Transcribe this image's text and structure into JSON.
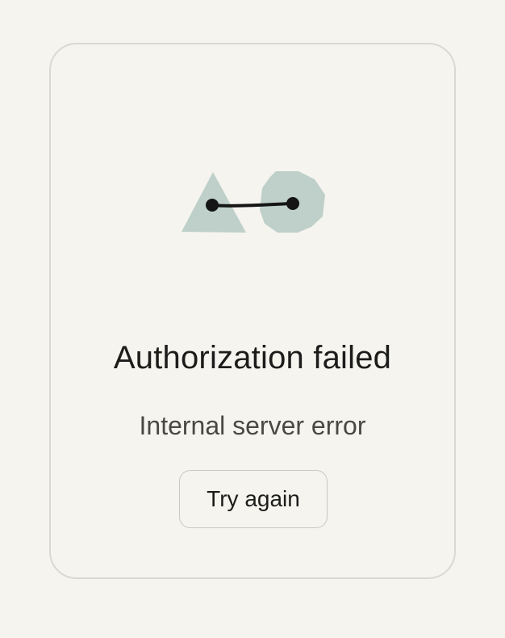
{
  "error": {
    "title": "Authorization failed",
    "message": "Internal server error",
    "retry_label": "Try again"
  },
  "illustration": {
    "icon": "disconnected-shapes-icon",
    "shape_color": "#bfd0ca",
    "line_color": "#151515"
  }
}
